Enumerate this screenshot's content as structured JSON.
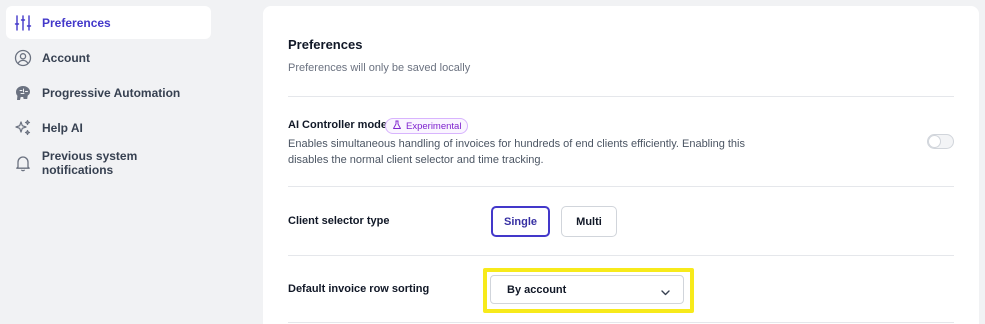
{
  "sidebar": {
    "items": [
      {
        "label": "Preferences",
        "icon": "sliders-icon",
        "active": true
      },
      {
        "label": "Account",
        "icon": "user-circle-icon"
      },
      {
        "label": "Progressive Automation",
        "icon": "brain-icon"
      },
      {
        "label": "Help AI",
        "icon": "sparkles-icon"
      },
      {
        "label": "Previous system notifications",
        "icon": "bell-icon"
      }
    ]
  },
  "main": {
    "title": "Preferences",
    "subtitle": "Preferences will only be saved locally",
    "ai_mode": {
      "label": "AI Controller mode",
      "badge": "Experimental",
      "description": "Enables simultaneous handling of invoices for hundreds of end clients efficiently. Enabling this disables the normal client selector and time tracking.",
      "enabled": false
    },
    "client_selector": {
      "label": "Client selector type",
      "options": [
        "Single",
        "Multi"
      ],
      "selected": "Single"
    },
    "row_sorting": {
      "label": "Default invoice row sorting",
      "value": "By account"
    }
  },
  "colors": {
    "accent": "#4338ca",
    "highlight": "#f7ea1b",
    "badge": "#7e22ce"
  }
}
